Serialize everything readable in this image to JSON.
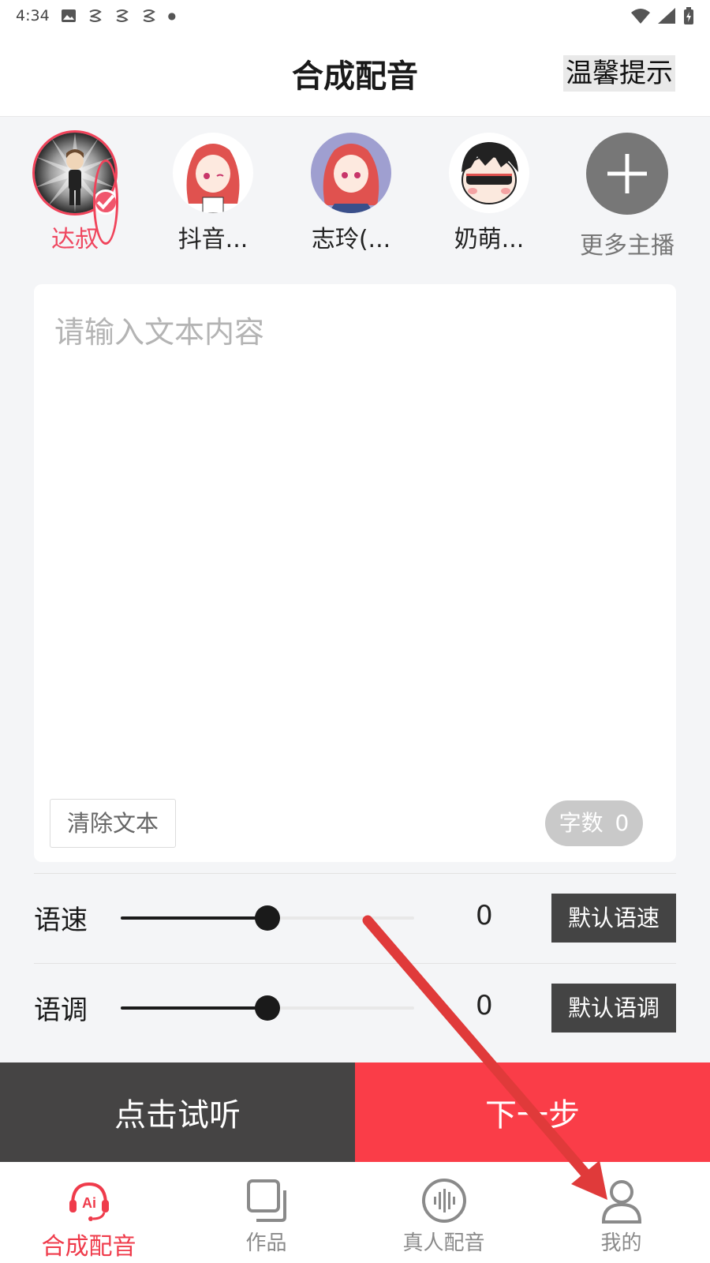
{
  "status_bar": {
    "time": "4:34",
    "left_icons": [
      "image-icon",
      "notification-icon",
      "notification-icon",
      "notification-icon",
      "dot-icon"
    ],
    "right_icons": [
      "wifi-icon",
      "signal-icon",
      "battery-icon"
    ]
  },
  "header": {
    "title": "合成配音",
    "tips_label": "温馨提示"
  },
  "anchors": {
    "items": [
      {
        "name": "达叔",
        "selected": true
      },
      {
        "name": "抖音..."
      },
      {
        "name": "志玲(..."
      },
      {
        "name": "奶萌..."
      }
    ],
    "more_label": "更多主播"
  },
  "editor": {
    "placeholder": "请输入文本内容",
    "value": "",
    "clear_label": "清除文本",
    "count_label": "字数",
    "count_value": "0"
  },
  "speed": {
    "label": "语速",
    "value": "0",
    "level_percent": 50,
    "default_label": "默认语速"
  },
  "pitch": {
    "label": "语调",
    "value": "0",
    "level_percent": 50,
    "default_label": "默认语调"
  },
  "actions": {
    "listen_label": "点击试听",
    "next_label": "下一步"
  },
  "bottom_nav": {
    "items": [
      {
        "label": "合成配音",
        "icon": "ai-headset-icon",
        "active": true
      },
      {
        "label": "作品",
        "icon": "works-icon"
      },
      {
        "label": "真人配音",
        "icon": "voice-wave-icon"
      },
      {
        "label": "我的",
        "icon": "user-icon"
      }
    ]
  },
  "colors": {
    "accent": "#fa3d48",
    "selected_text": "#ef4760",
    "dark_button": "#454444",
    "annotation_arrow": "#e03a3a"
  }
}
